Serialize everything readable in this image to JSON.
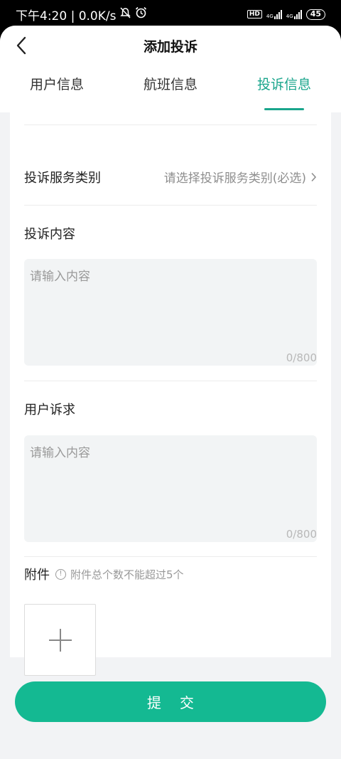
{
  "status_bar": {
    "time_speed": "下午4:20 | 0.0K/s",
    "hd": "HD",
    "net1": "4G",
    "net2": "4G",
    "battery": "45"
  },
  "header": {
    "title": "添加投诉",
    "back_icon": "chevron-left-icon"
  },
  "tabs": [
    {
      "label": "用户信息",
      "active": false
    },
    {
      "label": "航班信息",
      "active": false
    },
    {
      "label": "投诉信息",
      "active": true
    }
  ],
  "form": {
    "category": {
      "label": "投诉服务类别",
      "placeholder": "请选择投诉服务类别(必选)"
    },
    "content": {
      "label": "投诉内容",
      "placeholder": "请输入内容",
      "count": "0/800"
    },
    "demand": {
      "label": "用户诉求",
      "placeholder": "请输入内容",
      "count": "0/800"
    },
    "attachment": {
      "label": "附件",
      "hint": "附件总个数不能超过5个",
      "info_glyph": "!"
    }
  },
  "submit_label": "提交",
  "colors": {
    "accent": "#1aa58c",
    "button": "#14b992",
    "page_bg": "#f2f3f5"
  }
}
